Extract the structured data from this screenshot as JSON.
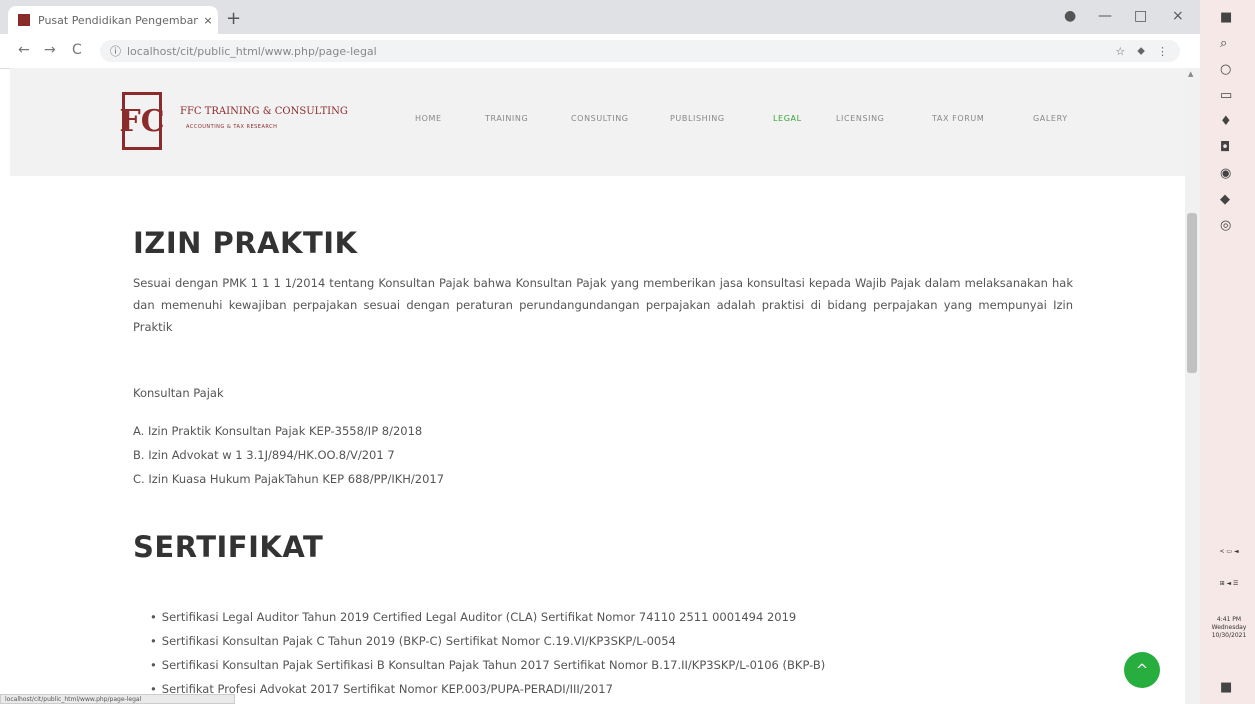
{
  "browser": {
    "tab_title": "Pusat Pendidikan Pengembangan ...",
    "tab_close": "×",
    "new_tab": "+",
    "url": "localhost/cit/public_html/www.php/page-legal",
    "back": "←",
    "forward": "→",
    "reload": "C",
    "info": "ⓘ",
    "ext1": "☆",
    "ext2": "⬥",
    "menu": "⋮",
    "win_profile": "●",
    "win_min": "—",
    "win_max": "□",
    "win_close": "×"
  },
  "site": {
    "logo_mark": "FC",
    "logo_name": "FFC TRAINING & CONSULTING",
    "logo_tagline": "ACCOUNTING & TAX RESEARCH",
    "nav": [
      {
        "label": "HOME"
      },
      {
        "label": "TRAINING"
      },
      {
        "label": "CONSULTING"
      },
      {
        "label": "PUBLISHING"
      },
      {
        "label": "LEGAL"
      },
      {
        "label": "LICENSING"
      },
      {
        "label": "TAX FORUM"
      },
      {
        "label": "GALERY"
      }
    ],
    "active_color": "#3aa23a",
    "brand_color": "#8b2b2b"
  },
  "content": {
    "h1_izin": "IZIN PRAKTIK",
    "paragraph": "Sesuai dengan PMK 1 1 1 1/2014 tentang Konsultan Pajak bahwa Konsultan Pajak yang memberikan jasa konsultasi kepada Wajib Pajak dalam melaksanakan hak dan memenuhi kewajiban perpajakan sesuai dengan peraturan perundangundangan perpajakan adalah praktisi di bidang perpajakan yang mempunyai Izin Praktik",
    "subhead": "Konsultan Pajak",
    "izin_list": [
      "A. Izin Praktik Konsultan Pajak KEP-3558/IP 8/2018",
      "B. Izin Advokat w 1 3.1J/894/HK.OO.8/V/201 7",
      "C. Izin Kuasa Hukum PajakTahun KEP 688/PP/IKH/2017"
    ],
    "h1_sertifikat": "SERTIFIKAT",
    "cert_list": [
      "Sertifikasi Legal Auditor Tahun 2019 Certified Legal Auditor (CLA) Sertifikat Nomor 74110 2511 0001494 2019",
      "Sertifikasi Konsultan Pajak C Tahun 2019 (BKP-C) Sertifikat Nomor C.19.VI/KP3SKP/L-0054",
      "Sertifikasi Konsultan Pajak Sertifikasi B Konsultan Pajak Tahun 2017 Sertifikat Nomor B.17.II/KP3SKP/L-0106 (BKP-B)",
      "Sertifikat Profesi Advokat 2017 Sertifikat Nomor KEP.003/PUPA-PERADI/III/2017"
    ],
    "bullet": "•"
  },
  "ui": {
    "back_to_top": "^",
    "status_text": "localhost/cit/public_html/www.php/page-legal",
    "scroll_up": "▲"
  },
  "taskbar": {
    "icons": [
      "■",
      "⌕",
      "○",
      "▭",
      "♦",
      "◘",
      "◉",
      "◆",
      "◎"
    ],
    "tray": "< ▭ ◄",
    "tray2": "⊞ ◄ ☰",
    "time": "4:41 PM",
    "day": "Wednesday",
    "date": "10/30/2021",
    "notif": "■"
  }
}
